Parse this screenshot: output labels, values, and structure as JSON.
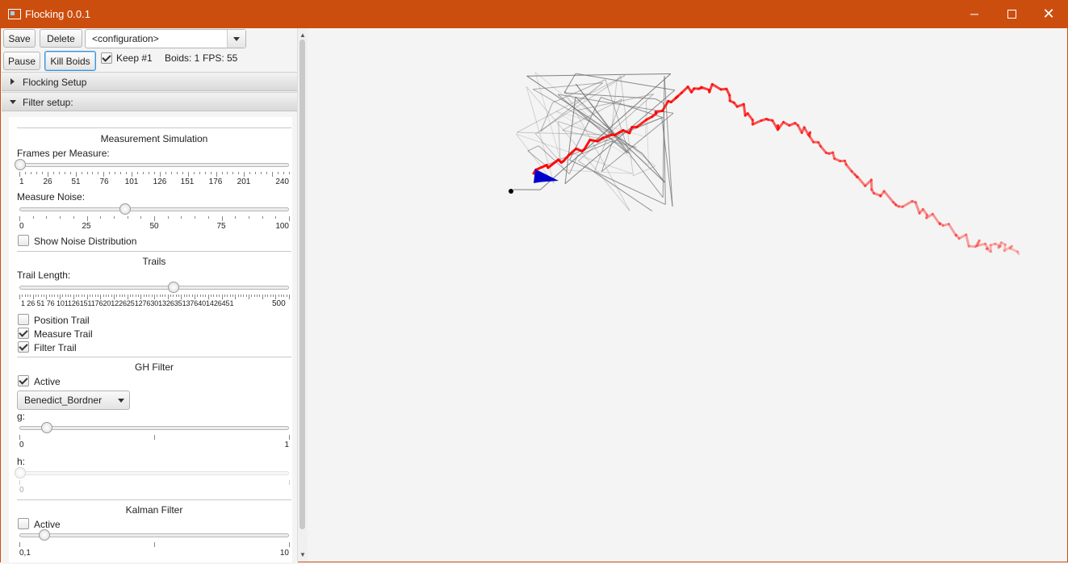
{
  "window": {
    "title": "Flocking 0.0.1",
    "minimize": "─",
    "close": "✕"
  },
  "toolbar": {
    "save": "Save",
    "delete": "Delete",
    "configuration": "<configuration>",
    "pause": "Pause",
    "kill_boids": "Kill Boids",
    "keep_label": "Keep #1",
    "keep_checked": true,
    "boids_status": "Boids: 1",
    "fps_status": "FPS: 55"
  },
  "panes": {
    "flocking_setup": {
      "label": "Flocking Setup",
      "expanded": false
    },
    "filter_setup": {
      "label": "Filter setup:",
      "expanded": true
    }
  },
  "measurement": {
    "title": "Measurement Simulation",
    "frames_label": "Frames per Measure:",
    "frames_value": 1,
    "frames_ticks": [
      "1",
      "26",
      "51",
      "76",
      "101",
      "126",
      "151",
      "176",
      "201",
      "240"
    ],
    "noise_label": "Measure Noise:",
    "noise_value": 40,
    "noise_ticks": [
      "0",
      "25",
      "50",
      "75",
      "100"
    ],
    "show_noise_label": "Show Noise Distribution",
    "show_noise_checked": false
  },
  "trails": {
    "title": "Trails",
    "length_label": "Trail Length:",
    "length_value": 250,
    "length_ticks_left": "1  26  51  76 101126151176201226251276301326351376401426451",
    "length_ticks_last": "500",
    "position_label": "Position Trail",
    "position_checked": false,
    "measure_label": "Measure Trail",
    "measure_checked": true,
    "filter_label": "Filter Trail",
    "filter_checked": true
  },
  "gh_filter": {
    "title": "GH Filter",
    "active_label": "Active",
    "active_checked": true,
    "type": "Benedict_Bordner",
    "g_label": "g:",
    "g_value": 0.1,
    "g_ticks": [
      "0",
      "1"
    ],
    "h_label": "h:",
    "h_value": 0,
    "h_ticks": [
      "0"
    ]
  },
  "kalman": {
    "title": "Kalman Filter",
    "active_label": "Active",
    "active_checked": false,
    "value": 1,
    "ticks": [
      "0,1",
      "10"
    ]
  },
  "colors": {
    "titlebar": "#cc4e0f",
    "filter_trail": "#ff0000",
    "measure_trail": "#707070",
    "boid": "#0000cc"
  }
}
